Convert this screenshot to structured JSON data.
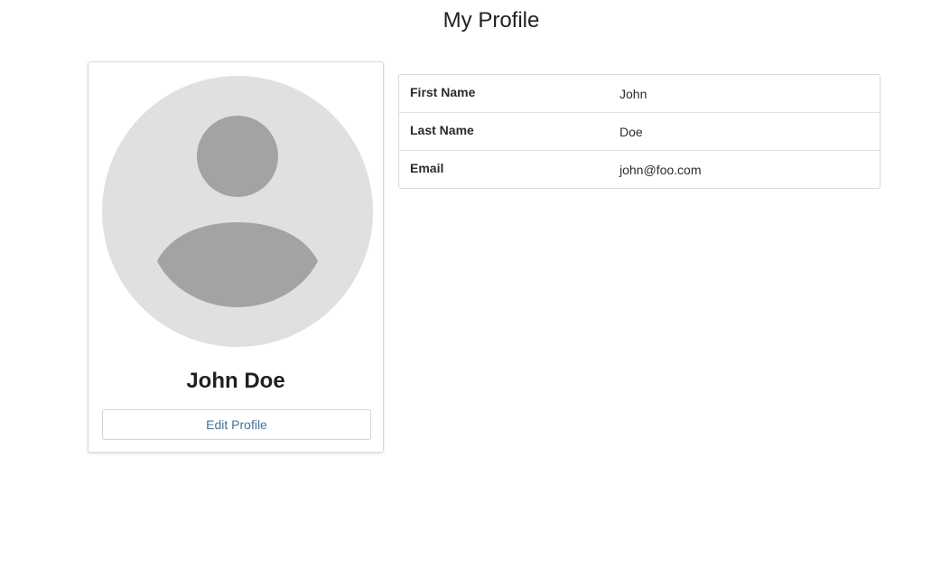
{
  "page": {
    "title": "My Profile"
  },
  "profile_card": {
    "name": "John Doe",
    "edit_button_label": "Edit Profile",
    "avatar_icon": "user-silhouette-icon"
  },
  "details": {
    "rows": [
      {
        "label": "First Name",
        "value": "John"
      },
      {
        "label": "Last Name",
        "value": "Doe"
      },
      {
        "label": "Email",
        "value": "john@foo.com"
      }
    ]
  },
  "colors": {
    "avatar_background": "#e0e0e0",
    "avatar_figure": "#a3a3a3",
    "button_text": "#4a7096",
    "border": "#d9d9d9"
  }
}
